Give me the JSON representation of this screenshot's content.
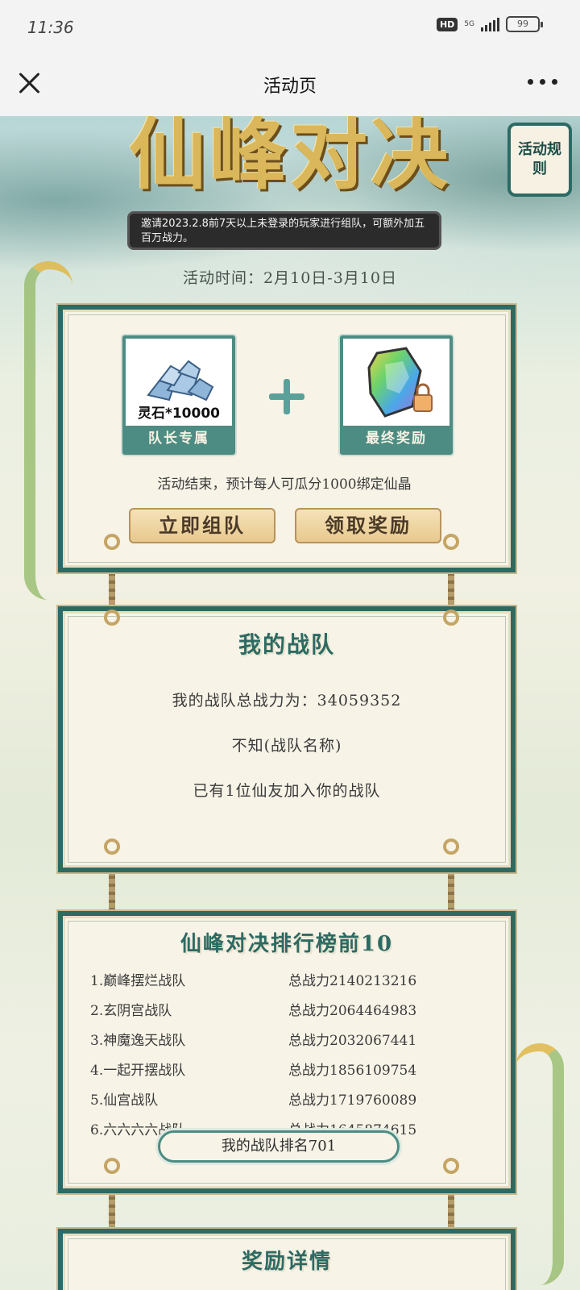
{
  "status_bar": {
    "time": "11:36",
    "hd_badge": "HD",
    "network": "5G",
    "battery": "99"
  },
  "nav": {
    "title": "活动页"
  },
  "hero": {
    "title": "仙峰对决",
    "rules_button": "活动规则",
    "invite_text": "邀请2023.2.8前7天以上未登录的玩家进行组队，可额外加五百万战力。",
    "event_time": "活动时间：2月10日-3月10日"
  },
  "rewards": {
    "captain_item_caption": "灵石*10000",
    "captain_label": "队长专属",
    "final_label": "最终奖励",
    "split_text": "活动结束，预计每人可瓜分1000绑定仙晶",
    "form_team_button": "立即组队",
    "claim_button": "领取奖励"
  },
  "my_team": {
    "heading": "我的战队",
    "total_power": "我的战队总战力为：34059352",
    "team_name": "不知(战队名称)",
    "members": "已有1位仙友加入你的战队"
  },
  "leaderboard": {
    "heading": "仙峰对决排行榜前10",
    "rows": [
      {
        "name": "1.巅峰摆烂战队",
        "power": "总战力2140213216"
      },
      {
        "name": "2.玄阴宫战队",
        "power": "总战力2064464983"
      },
      {
        "name": "3.神魔逸天战队",
        "power": "总战力2032067441"
      },
      {
        "name": "4.一起开摆战队",
        "power": "总战力1856109754"
      },
      {
        "name": "5.仙宫战队",
        "power": "总战力1719760089"
      },
      {
        "name": "6.六六六六战队",
        "power": "总战力1645874615"
      }
    ],
    "my_rank": "我的战队排名701"
  },
  "reward_details": {
    "heading": "奖励详情"
  }
}
